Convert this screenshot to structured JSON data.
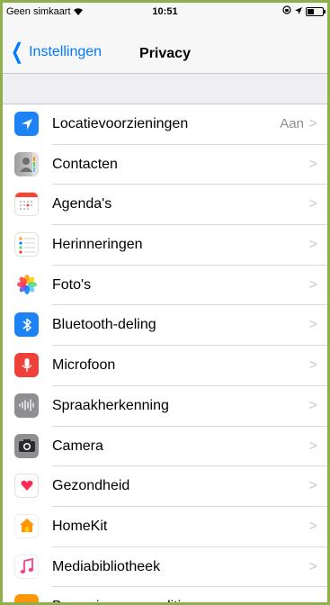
{
  "status_bar": {
    "carrier": "Geen simkaart",
    "time": "10:51"
  },
  "nav": {
    "back_label": "Instellingen",
    "title": "Privacy"
  },
  "rows": [
    {
      "label": "Locatievoorzieningen",
      "value": "Aan",
      "icon": "location-arrow-icon"
    },
    {
      "label": "Contacten",
      "value": "",
      "icon": "contacts-icon"
    },
    {
      "label": "Agenda's",
      "value": "",
      "icon": "calendar-icon"
    },
    {
      "label": "Herinneringen",
      "value": "",
      "icon": "reminders-icon"
    },
    {
      "label": "Foto's",
      "value": "",
      "icon": "photos-icon"
    },
    {
      "label": "Bluetooth-deling",
      "value": "",
      "icon": "bluetooth-icon"
    },
    {
      "label": "Microfoon",
      "value": "",
      "icon": "microphone-icon"
    },
    {
      "label": "Spraakherkenning",
      "value": "",
      "icon": "speech-recognition-icon"
    },
    {
      "label": "Camera",
      "value": "",
      "icon": "camera-icon"
    },
    {
      "label": "Gezondheid",
      "value": "",
      "icon": "health-heart-icon"
    },
    {
      "label": "HomeKit",
      "value": "",
      "icon": "homekit-icon"
    },
    {
      "label": "Mediabibliotheek",
      "value": "",
      "icon": "music-note-icon"
    },
    {
      "label": "Beweging en conditie",
      "value": "",
      "icon": "motion-fitness-icon"
    }
  ],
  "colors": {
    "accent": "#007aff",
    "background": "#efeff4",
    "frame": "#8db04a"
  }
}
